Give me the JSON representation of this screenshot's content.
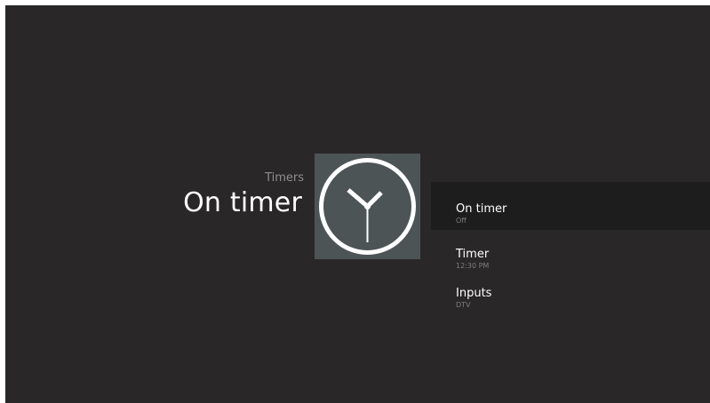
{
  "header": {
    "breadcrumb": "Timers",
    "title": "On timer",
    "icon": "clock-icon"
  },
  "colors": {
    "background": "#292728",
    "tile": "#4c5456",
    "selected_row": "#1e1d1e",
    "text_primary": "#ffffff",
    "text_secondary": "#7f7e80"
  },
  "menu": {
    "items": [
      {
        "label": "On timer",
        "value": "Off",
        "selected": true
      },
      {
        "label": "Timer",
        "value": "12:30 PM",
        "selected": false
      },
      {
        "label": "Inputs",
        "value": "DTV",
        "selected": false
      }
    ]
  }
}
